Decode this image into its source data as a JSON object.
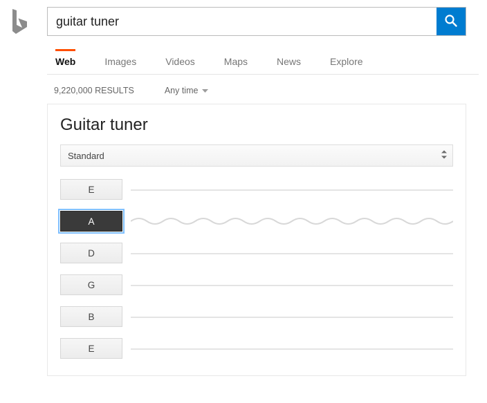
{
  "search": {
    "query": "guitar tuner"
  },
  "tabs": [
    "Web",
    "Images",
    "Videos",
    "Maps",
    "News",
    "Explore"
  ],
  "active_tab_index": 0,
  "results_count": "9,220,000 RESULTS",
  "time_filter": "Any time",
  "card": {
    "title": "Guitar tuner",
    "tuning_selected": "Standard",
    "strings": [
      "E",
      "A",
      "D",
      "G",
      "B",
      "E"
    ],
    "active_string_index": 1
  }
}
